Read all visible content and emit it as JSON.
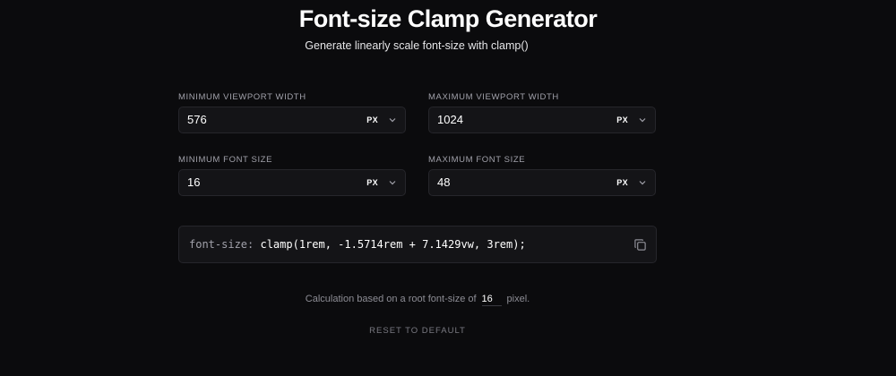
{
  "header": {
    "title": "Font-size Clamp Generator",
    "subtitle": "Generate linearly scale font-size with clamp()"
  },
  "fields": {
    "min_viewport": {
      "label": "MINIMUM VIEWPORT WIDTH",
      "value": "576",
      "unit": "PX"
    },
    "max_viewport": {
      "label": "MAXIMUM VIEWPORT WIDTH",
      "value": "1024",
      "unit": "PX"
    },
    "min_font": {
      "label": "MINIMUM FONT SIZE",
      "value": "16",
      "unit": "PX"
    },
    "max_font": {
      "label": "MAXIMUM FONT SIZE",
      "value": "48",
      "unit": "PX"
    }
  },
  "output": {
    "property": "font-size:",
    "value": "clamp(1rem, -1.5714rem + 7.1429vw, 3rem);",
    "copy_icon": "copy-icon"
  },
  "footer": {
    "calc_prefix": "Calculation based on a root font-size of",
    "root_value": "16",
    "calc_suffix": "pixel.",
    "reset_label": "RESET TO DEFAULT"
  },
  "icons": {
    "dropdown": "chevron-down-icon"
  },
  "colors": {
    "background": "#0b0b0d",
    "field_bg": "#141417",
    "border": "#26262b",
    "muted_text": "#a1a1aa"
  }
}
